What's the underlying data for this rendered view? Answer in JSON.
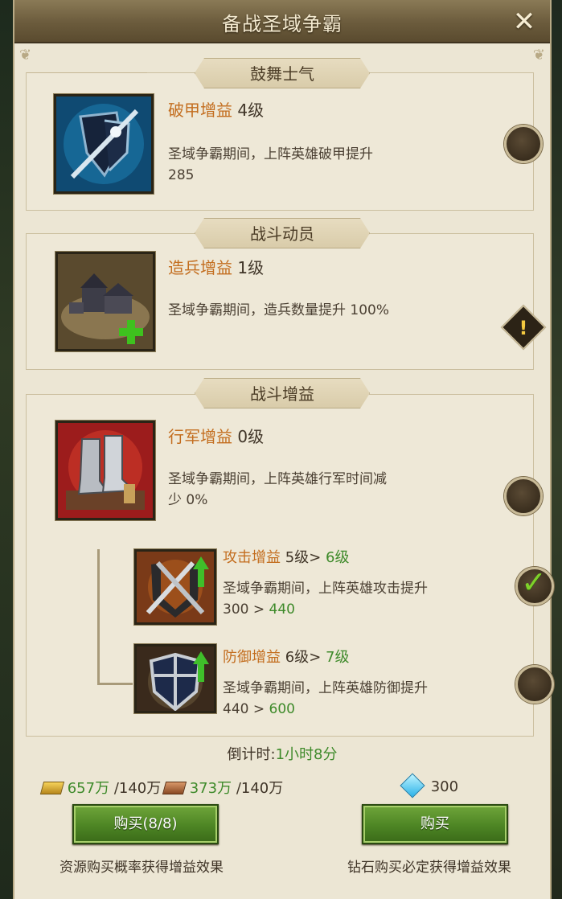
{
  "title": "备战圣域争霸",
  "close_symbol": "✕",
  "sections": [
    {
      "header": "鼓舞士气",
      "buff": {
        "name": "破甲增益",
        "level": "4级",
        "desc": "圣域争霸期间，上阵英雄破甲提升",
        "value": "285"
      }
    },
    {
      "header": "战斗动员",
      "buff": {
        "name": "造兵增益",
        "level": "1级",
        "desc": "圣域争霸期间，造兵数量提升 100%",
        "warn_symbol": "!"
      }
    },
    {
      "header": "战斗增益",
      "buff": {
        "name": "行军增益",
        "level": "0级",
        "desc_line1": "圣域争霸期间，上阵英雄行军时间减",
        "desc_line2": "少 0%"
      },
      "sub_buffs": [
        {
          "name": "攻击增益",
          "level_cur": "5级",
          "arrow": ">",
          "level_new": "6级",
          "desc": "圣域争霸期间，上阵英雄攻击提升",
          "val_cur": "300",
          "val_new": "440",
          "checked": true
        },
        {
          "name": "防御增益",
          "level_cur": "6级",
          "arrow": ">",
          "level_new": "7级",
          "desc": "圣域争霸期间，上阵英雄防御提升",
          "val_cur": "440",
          "val_new": "600",
          "checked": false
        }
      ]
    }
  ],
  "countdown": {
    "label": "倒计时:",
    "time": "1小时8分"
  },
  "resources": {
    "gold": {
      "have": "657万",
      "need": "/140万"
    },
    "wood": {
      "have": "373万",
      "need": "/140万"
    },
    "diamond": {
      "amount": "300"
    }
  },
  "buttons": {
    "resource_buy": "购买(8/8)",
    "diamond_buy": "购买",
    "resource_note": "资源购买概率获得增益效果",
    "diamond_note": "钻石购买必定获得增益效果"
  },
  "colors": {
    "accent_orange": "#c36d1e",
    "value_green": "#3e8a2a",
    "button_green": "#4d8524"
  }
}
